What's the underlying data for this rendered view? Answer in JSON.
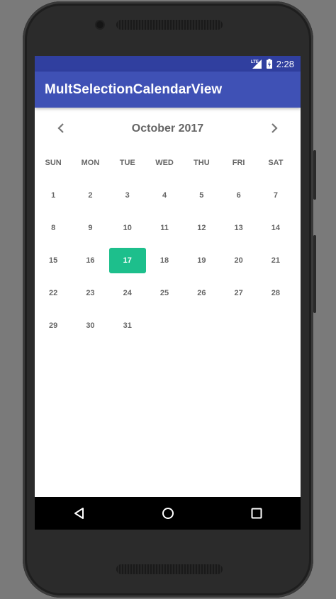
{
  "status_bar": {
    "network": "LTE",
    "time": "2:28"
  },
  "app_bar": {
    "title": "MultSelectionCalendarView"
  },
  "calendar": {
    "month_title": "October 2017",
    "weekdays": [
      "SUN",
      "MON",
      "TUE",
      "WED",
      "THU",
      "FRI",
      "SAT"
    ],
    "leading_blanks": 0,
    "days": [
      "1",
      "2",
      "3",
      "4",
      "5",
      "6",
      "7",
      "8",
      "9",
      "10",
      "11",
      "12",
      "13",
      "14",
      "15",
      "16",
      "17",
      "18",
      "19",
      "20",
      "21",
      "22",
      "23",
      "24",
      "25",
      "26",
      "27",
      "28",
      "29",
      "30",
      "31"
    ],
    "selected_day": "17",
    "selected_color": "#1dbf8c"
  },
  "colors": {
    "primary": "#3f51b5",
    "primary_dark": "#303f9f"
  },
  "nav_icons": [
    "back-icon",
    "home-icon",
    "recents-icon"
  ]
}
